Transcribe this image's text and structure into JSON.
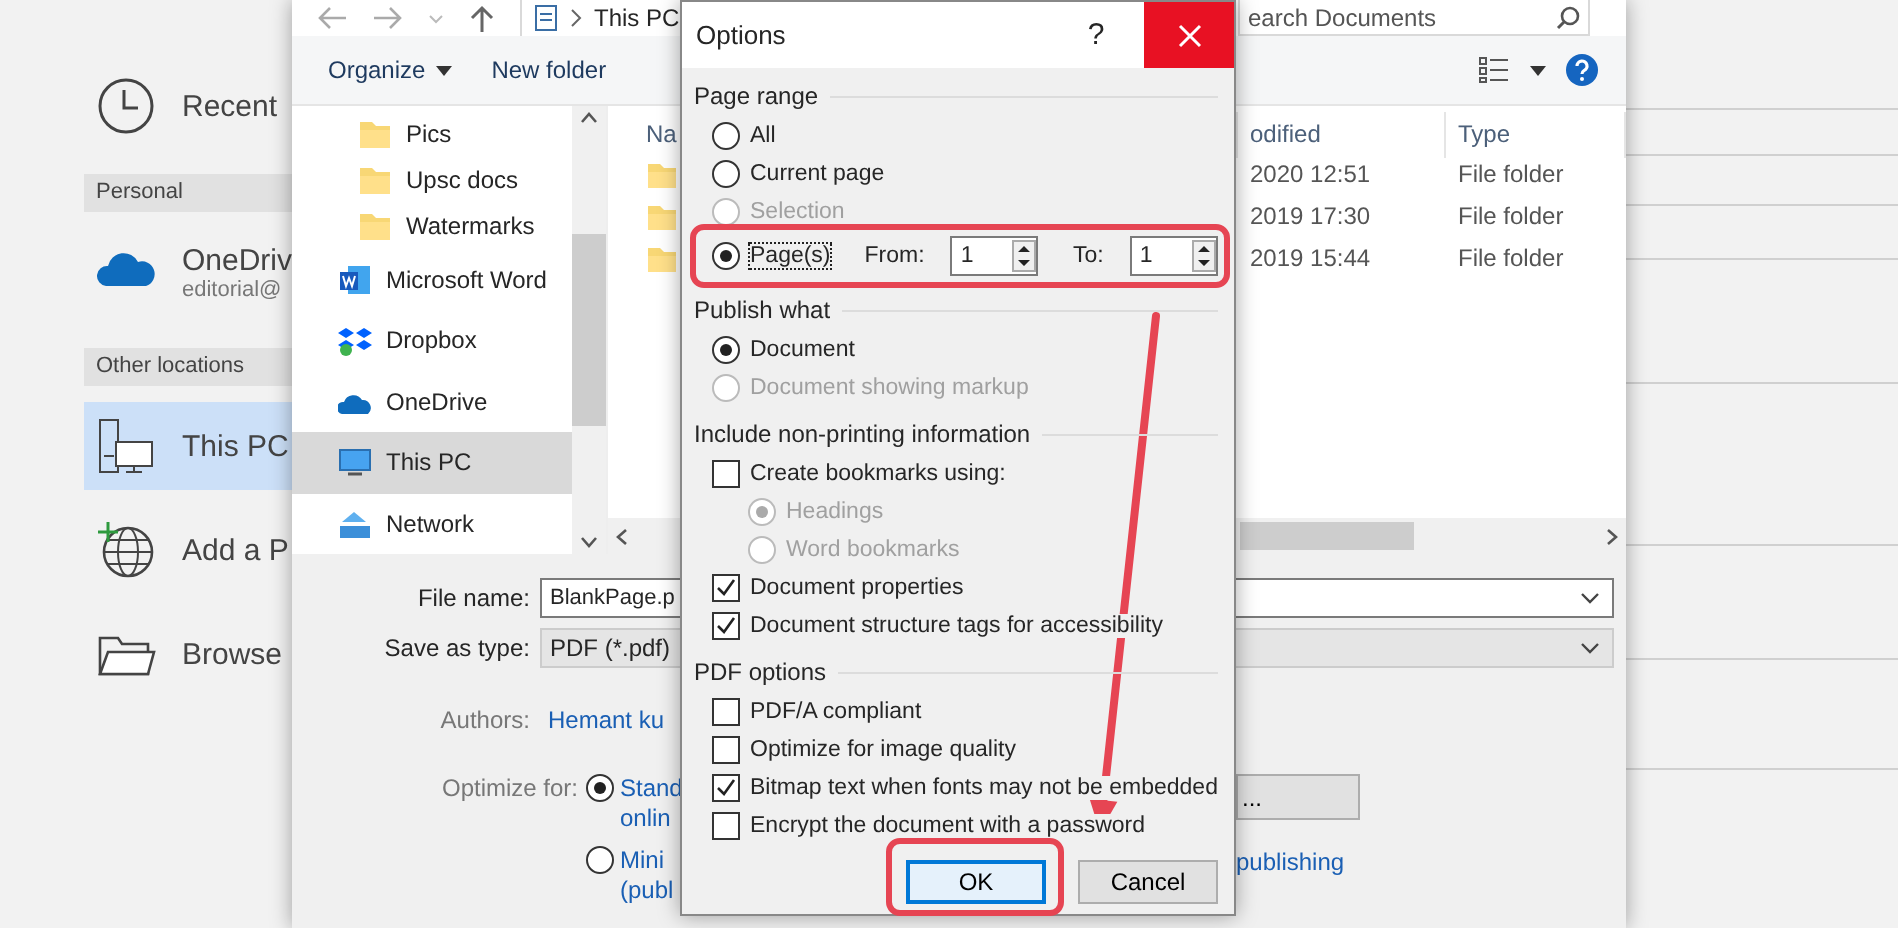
{
  "backstage": {
    "items": [
      {
        "kind": "place",
        "label": "Recent",
        "selected": false
      },
      {
        "kind": "header",
        "label": "Personal"
      },
      {
        "kind": "place",
        "label": "OneDriv",
        "sublabel": "editorial@",
        "selected": false
      },
      {
        "kind": "header",
        "label": "Other locations"
      },
      {
        "kind": "place",
        "label": "This PC",
        "selected": true
      },
      {
        "kind": "place",
        "label": "Add a P",
        "selected": false
      },
      {
        "kind": "place",
        "label": "Browse",
        "selected": false
      }
    ]
  },
  "save_dialog": {
    "address": "This PC",
    "search": {
      "placeholder": "earch Documents"
    },
    "toolbar": {
      "organize": "Organize",
      "new_folder": "New folder"
    },
    "nav_pane": [
      {
        "kind": "folder",
        "label": "Pics",
        "selected": false
      },
      {
        "kind": "folder",
        "label": "Upsc docs",
        "selected": false
      },
      {
        "kind": "folder",
        "label": "Watermarks",
        "selected": false
      },
      {
        "kind": "location",
        "label": "Microsoft Word",
        "selected": false
      },
      {
        "kind": "location",
        "label": "Dropbox",
        "selected": false
      },
      {
        "kind": "location",
        "label": "OneDrive",
        "selected": false
      },
      {
        "kind": "location",
        "label": "This PC",
        "selected": true
      },
      {
        "kind": "location",
        "label": "Network",
        "selected": false
      }
    ],
    "file_list": {
      "columns": [
        "Na",
        "odified",
        "Type"
      ],
      "rows": [
        {
          "date": "2020 12:51",
          "type": "File folder"
        },
        {
          "date": "2019 17:30",
          "type": "File folder"
        },
        {
          "date": "2019 15:44",
          "type": "File folder"
        }
      ]
    },
    "file_name": {
      "label": "File name:",
      "value": "BlankPage.p"
    },
    "save_as_type": {
      "label": "Save as type:",
      "value": "PDF (*.pdf)"
    },
    "authors": {
      "label": "Authors:",
      "value": "Hemant ku"
    },
    "optimize": {
      "label": "Optimize for:",
      "options": [
        {
          "lines": [
            "Stand",
            "onlin"
          ],
          "selected": true
        },
        {
          "lines": [
            "Mini",
            "(publ"
          ],
          "selected": false
        }
      ]
    },
    "options_button": "...",
    "publishing_link": "publishing"
  },
  "options_dialog": {
    "title": "Options",
    "help": "?",
    "sections": [
      {
        "heading": "Page range",
        "items": [
          {
            "kind": "radio",
            "label": "All",
            "selected": false,
            "disabled": false
          },
          {
            "kind": "radio",
            "label": "Current page",
            "selected": false,
            "disabled": false
          },
          {
            "kind": "radio",
            "label": "Selection",
            "selected": false,
            "disabled": true
          },
          {
            "kind": "pages",
            "label": "Page(s)",
            "selected": true,
            "disabled": false,
            "focused": true,
            "highlighted": true,
            "from_label": "From:",
            "from_value": "1",
            "to_label": "To:",
            "to_value": "1"
          }
        ]
      },
      {
        "heading": "Publish what",
        "items": [
          {
            "kind": "radio",
            "label": "Document",
            "selected": true,
            "disabled": false
          },
          {
            "kind": "radio",
            "label": "Document showing markup",
            "selected": false,
            "disabled": true
          }
        ]
      },
      {
        "heading": "Include non-printing information",
        "items": [
          {
            "kind": "checkbox",
            "label": "Create bookmarks using:",
            "checked": false,
            "disabled": false,
            "children": [
              {
                "kind": "radio",
                "label": "Headings",
                "selected": true,
                "disabled": true
              },
              {
                "kind": "radio",
                "label": "Word bookmarks",
                "selected": false,
                "disabled": true
              }
            ]
          },
          {
            "kind": "checkbox",
            "label": "Document properties",
            "checked": true,
            "disabled": false
          },
          {
            "kind": "checkbox",
            "label": "Document structure tags for accessibility",
            "checked": true,
            "disabled": false
          }
        ]
      },
      {
        "heading": "PDF options",
        "items": [
          {
            "kind": "checkbox",
            "label": "PDF/A compliant",
            "checked": false,
            "disabled": false
          },
          {
            "kind": "checkbox",
            "label": "Optimize for image quality",
            "checked": false,
            "disabled": false
          },
          {
            "kind": "checkbox",
            "label": "Bitmap text when fonts may not be embedded",
            "checked": true,
            "disabled": false
          },
          {
            "kind": "checkbox",
            "label": "Encrypt the document with a password",
            "checked": false,
            "disabled": false
          }
        ]
      }
    ],
    "buttons": [
      {
        "label": "OK",
        "focused": true,
        "highlighted": true
      },
      {
        "label": "Cancel",
        "focused": false,
        "highlighted": false
      }
    ]
  },
  "annotation": {
    "kind": "arrow"
  }
}
